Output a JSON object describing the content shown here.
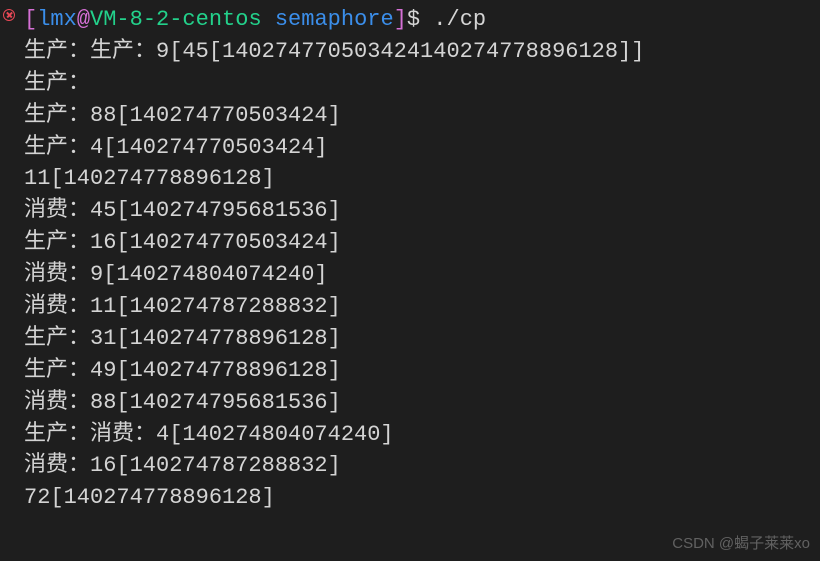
{
  "prompt": {
    "open_bracket": "[",
    "user": "lmx",
    "at": "@",
    "host": "VM-8-2-centos",
    "space": " ",
    "path": "semaphore",
    "close_bracket": "]",
    "dollar": "$ ",
    "command": "./cp"
  },
  "output": {
    "line1": "生产：生产：9[45[140274770503424140274778896128]]",
    "line2": "生产：",
    "line3": "生产：88[140274770503424]",
    "line4": "生产：4[140274770503424]",
    "line5": "11[140274778896128]",
    "line6": "消费：45[140274795681536]",
    "line7": "生产：16[140274770503424]",
    "line8": "消费：9[140274804074240]",
    "line9": "消费：11[140274787288832]",
    "line10": "生产：31[140274778896128]",
    "line11": "生产：49[140274778896128]",
    "line12": "消费：88[140274795681536]",
    "line13": "生产：消费：4[140274804074240]",
    "line14": "消费：16[140274787288832]",
    "line15": "72[140274778896128]"
  },
  "watermark": "CSDN @蝎子莱莱xo"
}
